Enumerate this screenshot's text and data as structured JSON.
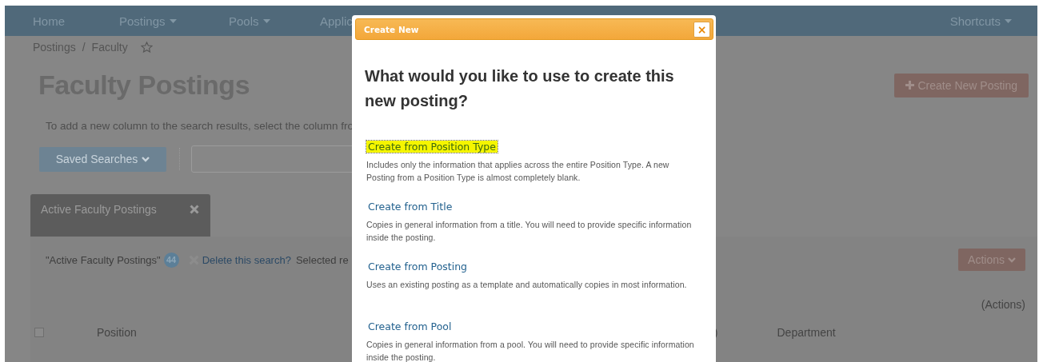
{
  "nav": {
    "items": [
      {
        "label": "Home",
        "dropdown": false
      },
      {
        "label": "Postings",
        "dropdown": true
      },
      {
        "label": "Pools",
        "dropdown": true
      },
      {
        "label": "Applic",
        "dropdown": false
      }
    ],
    "right": {
      "label": "Shortcuts",
      "dropdown": true
    }
  },
  "breadcrumb": [
    "Postings",
    "/",
    "Faculty"
  ],
  "page_title": "Faculty Postings",
  "create_button": "Create New Posting",
  "help_text": "To add a new column to the search results, select the column fro",
  "saved_searches_button": "Saved Searches",
  "search_tab": {
    "label": "Active Faculty Postings"
  },
  "results": {
    "search_name": "\"Active Faculty Postings\"",
    "count": "44",
    "delete_link": "Delete this search?",
    "selected_text": "Selected re",
    "actions_button": "Actions",
    "actions_header": "(Actions)",
    "select_all": {
      "checked": false
    },
    "columns": [
      "Position",
      ")",
      "Department"
    ]
  },
  "modal": {
    "title": "Create New",
    "close": "×",
    "heading": "What would you like to use to create this new posting?",
    "options": [
      {
        "label": "Create from Position Type",
        "highlighted": true,
        "description": "Includes only the information that applies across the entire Position Type. A new Posting from a Position Type is almost completely blank."
      },
      {
        "label": "Create from Title",
        "highlighted": false,
        "description": "Copies in general information from a title. You will need to provide specific information inside the posting."
      },
      {
        "label": "Create from Posting",
        "highlighted": false,
        "description": "Uses an existing posting as a template and automatically copies in most information."
      },
      {
        "label": "Create from Pool",
        "highlighted": false,
        "description": "Copies in general information from a pool. You will need to provide specific information inside the posting."
      }
    ]
  }
}
